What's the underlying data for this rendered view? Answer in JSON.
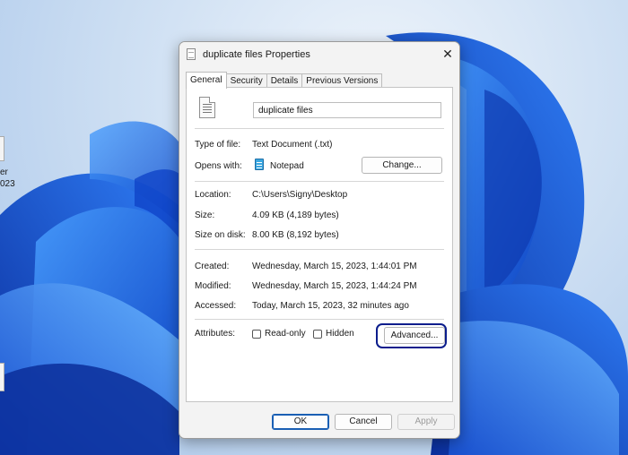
{
  "desktop": {
    "partial_icon_text_1": "er",
    "partial_icon_text_2": "023"
  },
  "dialog": {
    "title": "duplicate files Properties",
    "close_glyph": "✕",
    "tabs": [
      {
        "label": "General",
        "active": true
      },
      {
        "label": "Security",
        "active": false
      },
      {
        "label": "Details",
        "active": false
      },
      {
        "label": "Previous Versions",
        "active": false
      }
    ],
    "general": {
      "file_name": "duplicate files",
      "type_label": "Type of file:",
      "type_value": "Text Document (.txt)",
      "opens_label": "Opens with:",
      "opens_value": "Notepad",
      "change_button": "Change...",
      "location_label": "Location:",
      "location_value": "C:\\Users\\Signy\\Desktop",
      "size_label": "Size:",
      "size_value": "4.09 KB (4,189 bytes)",
      "size_on_disk_label": "Size on disk:",
      "size_on_disk_value": "8.00 KB (8,192 bytes)",
      "created_label": "Created:",
      "created_value": "Wednesday, March 15, 2023, 1:44:01 PM",
      "modified_label": "Modified:",
      "modified_value": "Wednesday, March 15, 2023, 1:44:24 PM",
      "accessed_label": "Accessed:",
      "accessed_value": "Today, March 15, 2023, 32 minutes ago",
      "attributes_label": "Attributes:",
      "readonly_label": "Read-only",
      "readonly_checked": false,
      "hidden_label": "Hidden",
      "hidden_checked": false,
      "advanced_button": "Advanced..."
    },
    "footer": {
      "ok": "OK",
      "cancel": "Cancel",
      "apply": "Apply"
    }
  },
  "colors": {
    "highlight_border": "#0b1d8c",
    "wallpaper_blue": "#1a5fe0",
    "default_button_border": "#1a5fb4"
  }
}
